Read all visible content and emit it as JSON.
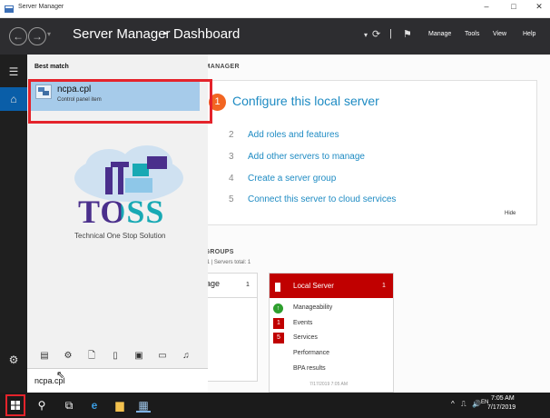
{
  "window": {
    "title": "Server Manager",
    "minimize": "–",
    "restore": "□",
    "close": "✕"
  },
  "header": {
    "back_glyph": "←",
    "forward_glyph": "→",
    "dropdown_glyph": "▾",
    "title": "Server Manager",
    "separator": "▸",
    "page": "Dashboard",
    "refresh_glyph": "⟳",
    "divider_glyph": "|",
    "flag_glyph": "⚑",
    "menus": [
      "Manage",
      "Tools",
      "View",
      "Help"
    ]
  },
  "rail": {
    "expand_glyph": "☰",
    "home_glyph": "⌂",
    "settings_glyph": "⚙"
  },
  "dashboard": {
    "section_title": "R MANAGER",
    "quick_start": {
      "active_number": "1",
      "active_label": "Configure this local server",
      "steps": [
        {
          "num": "2",
          "label": "Add roles and features"
        },
        {
          "num": "3",
          "label": "Add other servers to manage"
        },
        {
          "num": "4",
          "label": "Create a server group"
        },
        {
          "num": "5",
          "label": "Connect this server to cloud services"
        }
      ],
      "hide": "Hide"
    },
    "groups_title": "R GROUPS",
    "groups_subtitle": "ps: 1  |  Servers total: 1",
    "storage_tile": {
      "title": "orage",
      "count": "1",
      "row": "ty"
    },
    "local_server_tile": {
      "title": "Local Server",
      "count": "1",
      "header_color": "#c00000",
      "rows": [
        {
          "badge": "↑",
          "label": "Manageability"
        },
        {
          "badge": "1",
          "label": "Events"
        },
        {
          "badge": "5",
          "label": "Services"
        },
        {
          "badge": "",
          "label": "Performance"
        },
        {
          "badge": "",
          "label": "BPA results"
        }
      ],
      "footer": "7/17/2019 7:05 AM"
    }
  },
  "search_popup": {
    "best_match_label": "Best match",
    "result": {
      "name": "ncpa.cpl",
      "type": "Control panel item"
    },
    "watermark": {
      "title": "TOSS",
      "subtitle": "Technical One Stop Solution"
    },
    "filter_icons": [
      "▤",
      "⚙",
      "🗋",
      "▯",
      "▣",
      "▭",
      "♫"
    ],
    "query": "ncpa.cpl",
    "cursor_glyph": "⇖"
  },
  "taskbar": {
    "search_glyph": "⚲",
    "taskview_glyph": "⧉",
    "ie_glyph": "e",
    "explorer_glyph": "▆",
    "server_manager_glyph": "▦",
    "tray": [
      "^",
      "⎍",
      "🔊",
      "EN"
    ],
    "time": "7:05 AM",
    "date": "7/17/2019"
  },
  "colors": {
    "accent_blue": "#1e8bc3",
    "highlight_red": "#e4232b",
    "orange_step": "#f26522"
  }
}
